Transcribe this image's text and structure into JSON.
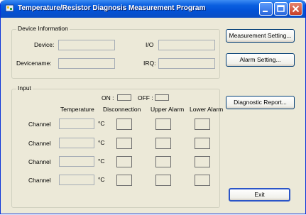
{
  "window": {
    "title": "Temperature/Resistor Diagnosis Measurement Program"
  },
  "device_info": {
    "legend": "Device Information",
    "device_label": "Device:",
    "device_value": "",
    "devicename_label": "Devicename:",
    "devicename_value": "",
    "io_label": "I/O",
    "io_value": "",
    "irq_label": "IRQ:",
    "irq_value": ""
  },
  "input": {
    "legend": "Input",
    "on_label": "ON :",
    "off_label": "OFF :",
    "col_temperature": "Temperature",
    "col_disconnection": "Disconnection",
    "col_upper_alarm": "Upper Alarm",
    "col_lower_alarm": "Lower Alarm",
    "rows": [
      {
        "channel_label": "Channel",
        "temperature": "",
        "unit": "°C"
      },
      {
        "channel_label": "Channel",
        "temperature": "",
        "unit": "°C"
      },
      {
        "channel_label": "Channel",
        "temperature": "",
        "unit": "°C"
      },
      {
        "channel_label": "Channel",
        "temperature": "",
        "unit": "°C"
      }
    ]
  },
  "buttons": {
    "measurement_setting": "Measurement Setting...",
    "alarm_setting": "Alarm Setting...",
    "diagnostic_report": "Diagnostic Report...",
    "exit": "Exit"
  }
}
